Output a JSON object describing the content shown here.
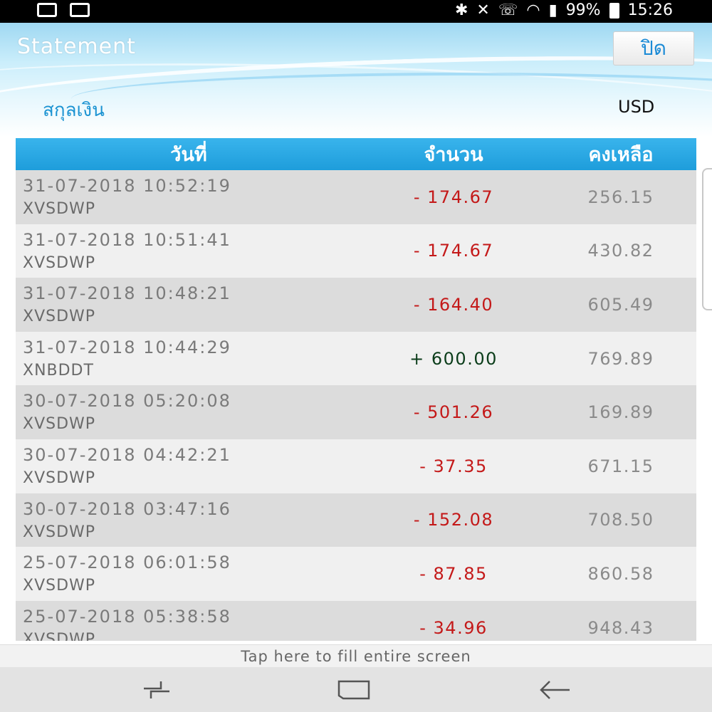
{
  "status_bar": {
    "left_icons": [
      "mail-icon",
      "inbox-icon"
    ],
    "right_icons": [
      "bluetooth-icon",
      "mute-icon",
      "wifi-call-icon",
      "wifi-icon",
      "signal-icon"
    ],
    "battery": "99%",
    "time": "15:26"
  },
  "header": {
    "title": "Statement",
    "close_label": "ปิด",
    "currency_label": "สกุลเงิน",
    "currency_value": "USD"
  },
  "table": {
    "columns": [
      "วันที่",
      "จำนวน",
      "คงเหลือ"
    ],
    "rows": [
      {
        "datetime": "31-07-2018 10:52:19",
        "code": "XVSDWP",
        "amount": "- 174.67",
        "sign": "neg",
        "balance": "256.15"
      },
      {
        "datetime": "31-07-2018 10:51:41",
        "code": "XVSDWP",
        "amount": "- 174.67",
        "sign": "neg",
        "balance": "430.82"
      },
      {
        "datetime": "31-07-2018 10:48:21",
        "code": "XVSDWP",
        "amount": "- 164.40",
        "sign": "neg",
        "balance": "605.49"
      },
      {
        "datetime": "31-07-2018 10:44:29",
        "code": "XNBDDT",
        "amount": "+ 600.00",
        "sign": "pos",
        "balance": "769.89"
      },
      {
        "datetime": "30-07-2018 05:20:08",
        "code": "XVSDWP",
        "amount": "- 501.26",
        "sign": "neg",
        "balance": "169.89"
      },
      {
        "datetime": "30-07-2018 04:42:21",
        "code": "XVSDWP",
        "amount": "- 37.35",
        "sign": "neg",
        "balance": "671.15"
      },
      {
        "datetime": "30-07-2018 03:47:16",
        "code": "XVSDWP",
        "amount": "- 152.08",
        "sign": "neg",
        "balance": "708.50"
      },
      {
        "datetime": "25-07-2018 06:01:58",
        "code": "XVSDWP",
        "amount": "- 87.85",
        "sign": "neg",
        "balance": "860.58"
      },
      {
        "datetime": "25-07-2018 05:38:58",
        "code": "XVSDWP",
        "amount": "- 34.96",
        "sign": "neg",
        "balance": "948.43"
      }
    ]
  },
  "tap_bar": {
    "text": "Tap here to fill entire screen"
  },
  "nav_bar": {
    "icons": [
      "recent-apps-icon",
      "home-icon",
      "back-icon"
    ]
  },
  "colors": {
    "header_blue": "#1e9ddb",
    "negative": "#c41919",
    "positive": "#0b3d1a",
    "currency_label": "#1b93d2"
  }
}
